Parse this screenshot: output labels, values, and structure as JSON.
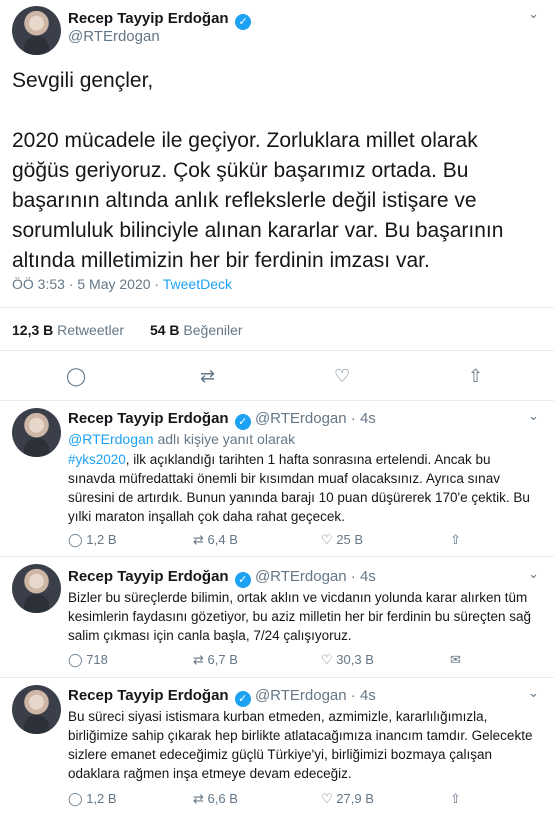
{
  "main_tweet": {
    "author_name": "Recep Tayyip Erdoğan",
    "handle": "@RTErdogan",
    "text": "Sevgili gençler,\n\n2020 mücadele ile geçiyor. Zorluklara millet olarak göğüs geriyoruz. Çok şükür başarımız ortada. Bu başarının altında anlık reflekslerle değil istişare ve sorumluluk bilinciyle alınan kararlar var. Bu başarının altında milletimizin her bir ferdinin imzası var.",
    "time": "ÖÖ 3:53",
    "date": "5 May 2020",
    "source": "TweetDeck",
    "retweet_count": "12,3 B",
    "retweet_label": "Retweetler",
    "like_count": "54 B",
    "like_label": "Beğeniler"
  },
  "replies": [
    {
      "author_name": "Recep Tayyip Erdoğan",
      "handle": "@RTErdogan",
      "time": "4s",
      "reply_to_handle": "@RTErdogan",
      "reply_to_suffix": "adlı kişiye yanıt olarak",
      "hashtag": "#yks2020",
      "text": ", ilk açıklandığı tarihten 1 hafta sonrasına ertelendi. Ancak bu sınavda müfredattaki önemli bir kısımdan muaf olacaksınız. Ayrıca sınav süresini de artırdık. Bunun yanında barajı 10 puan düşürerek 170'e çektik. Bu yılki maraton inşallah çok daha rahat geçecek.",
      "replies": "1,2 B",
      "retweets": "6,4 B",
      "likes": "25 B"
    },
    {
      "author_name": "Recep Tayyip Erdoğan",
      "handle": "@RTErdogan",
      "time": "4s",
      "text": "Bizler bu süreçlerde bilimin, ortak aklın ve vicdanın yolunda karar alırken tüm kesimlerin faydasını gözetiyor, bu aziz milletin her bir ferdinin bu süreçten sağ salim çıkması için canla başla, 7/24 çalışıyoruz.",
      "replies": "718",
      "retweets": "6,7 B",
      "likes": "30,3 B"
    },
    {
      "author_name": "Recep Tayyip Erdoğan",
      "handle": "@RTErdogan",
      "time": "4s",
      "text": "Bu süreci siyasi istismara kurban etmeden, azmimizle, kararlılığımızla, birliğimize sahip çıkarak hep birlikte atlatacağımıza inancım tamdır. Gelecekte sizlere emanet edeceğimiz güçlü Türkiye'yi, birliğimizi bozmaya çalışan odaklara rağmen inşa etmeye devam edeceğiz.",
      "replies": "1,2 B",
      "retweets": "6,6 B",
      "likes": "27,9 B"
    }
  ],
  "icons": {
    "verified": "✓",
    "chevron": "⌄",
    "reply": "◯",
    "retweet": "⇄",
    "like": "♡",
    "share": "⇧",
    "envelope": "✉"
  },
  "colors": {
    "accent": "#1da1f2",
    "text": "#14171a",
    "secondary": "#657786"
  }
}
